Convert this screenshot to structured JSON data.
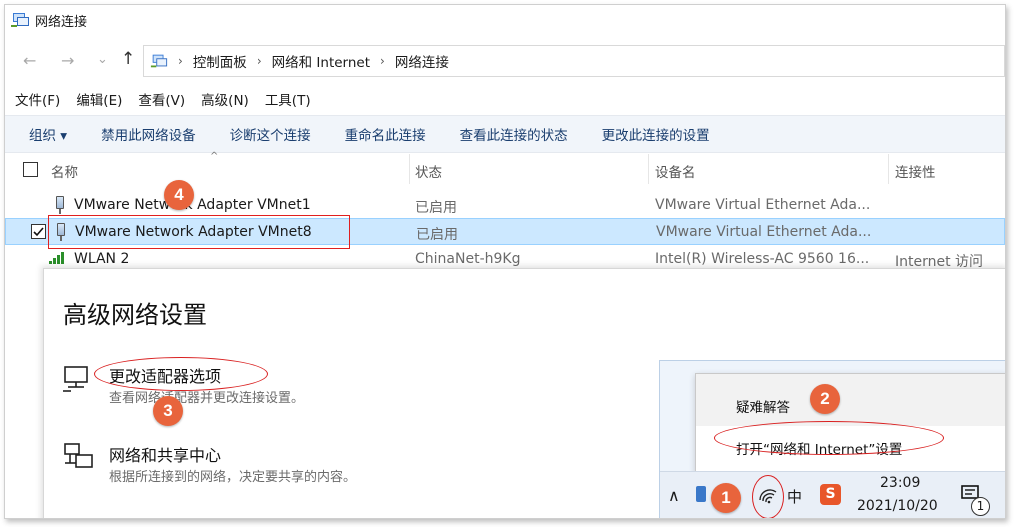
{
  "window": {
    "title": "网络连接"
  },
  "address": {
    "crumbs": [
      "控制面板",
      "网络和 Internet",
      "网络连接"
    ]
  },
  "nav": {
    "back": "←",
    "forward": "→",
    "recent": "⌄",
    "up": "↑",
    "chevron": "›"
  },
  "menu": [
    "文件(F)",
    "编辑(E)",
    "查看(V)",
    "高级(N)",
    "工具(T)"
  ],
  "commands": [
    "组织 ▾",
    "禁用此网络设备",
    "诊断这个连接",
    "重命名此连接",
    "查看此连接的状态",
    "更改此连接的设置"
  ],
  "columns": {
    "name": "名称",
    "status": "状态",
    "device": "设备名",
    "connectivity": "连接性"
  },
  "rows": [
    {
      "name": "VMware Network Adapter VMnet1",
      "status": "已启用",
      "device": "VMware Virtual Ethernet Ada...",
      "connectivity": ""
    },
    {
      "name": "VMware Network Adapter VMnet8",
      "status": "已启用",
      "device": "VMware Virtual Ethernet Ada...",
      "connectivity": "",
      "selected": true
    },
    {
      "name": "WLAN 2",
      "status": "ChinaNet-h9Kg",
      "device": "Intel(R) Wireless-AC 9560 16...",
      "connectivity": "Internet 访问"
    }
  ],
  "panel": {
    "heading": "高级网络设置",
    "options": [
      {
        "title": "更改适配器选项",
        "desc": "查看网络适配器并更改连接设置。"
      },
      {
        "title": "网络和共享中心",
        "desc": "根据所连接到的网络，决定要共享的内容。"
      }
    ]
  },
  "tray_popup": {
    "item1": "疑难解答",
    "item2": "打开“网络和 Internet”设置"
  },
  "taskbar": {
    "time": "23:09",
    "date": "2021/10/20",
    "ime": "中",
    "notification_count": "1",
    "chevron": "∧",
    "sogou": "S"
  },
  "annotations": [
    "1",
    "2",
    "3",
    "4"
  ],
  "colors": {
    "annotation": "#e8643c",
    "highlight": "#e02020",
    "selection": "#cce8ff",
    "command_text": "#1a3e6f"
  }
}
